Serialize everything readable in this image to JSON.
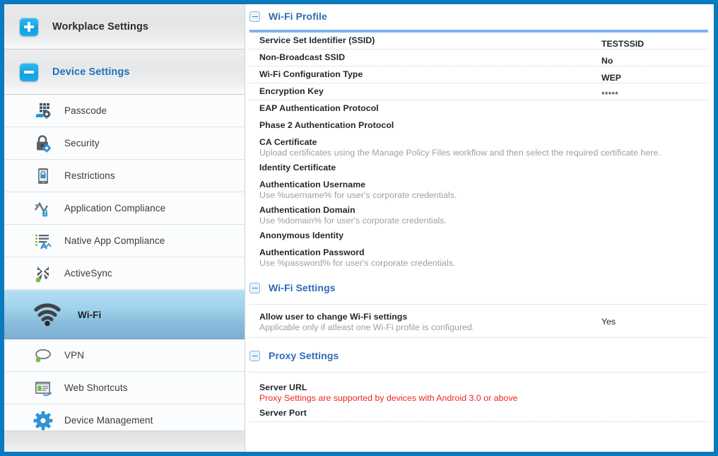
{
  "sidebar": {
    "headers": [
      {
        "label": "Workplace Settings",
        "icon": "plus-toggle-icon",
        "state": "collapsed"
      },
      {
        "label": "Device Settings",
        "icon": "minus-toggle-icon",
        "state": "expanded"
      }
    ],
    "items": [
      {
        "label": "Passcode",
        "icon": "passcode-icon",
        "selected": false
      },
      {
        "label": "Security",
        "icon": "security-lock-icon",
        "selected": false
      },
      {
        "label": "Restrictions",
        "icon": "restrictions-icon",
        "selected": false
      },
      {
        "label": "Application Compliance",
        "icon": "application-compliance-icon",
        "selected": false
      },
      {
        "label": "Native App Compliance",
        "icon": "native-app-compliance-icon",
        "selected": false
      },
      {
        "label": "ActiveSync",
        "icon": "activesync-icon",
        "selected": false
      },
      {
        "label": "Wi-Fi",
        "icon": "wifi-icon",
        "selected": true
      },
      {
        "label": "VPN",
        "icon": "vpn-icon",
        "selected": false
      },
      {
        "label": "Web Shortcuts",
        "icon": "web-shortcuts-icon",
        "selected": false
      },
      {
        "label": "Device Management",
        "icon": "device-management-gear-icon",
        "selected": false
      }
    ]
  },
  "main": {
    "sections": [
      {
        "title": "Wi-Fi Profile",
        "toggle_icon": "collapse-minus-icon",
        "rows": [
          {
            "label": "Service Set Identifier (SSID)",
            "hint": "",
            "value": "TESTSSID"
          },
          {
            "label": "Non-Broadcast SSID",
            "hint": "",
            "value": "No"
          },
          {
            "label": "Wi-Fi Configuration Type",
            "hint": "",
            "value": "WEP"
          },
          {
            "label": "Encryption Key",
            "hint": "",
            "value": "*****"
          },
          {
            "label": "EAP Authentication Protocol",
            "hint": "",
            "value": ""
          },
          {
            "label": "Phase 2 Authentication Protocol",
            "hint": "",
            "value": ""
          },
          {
            "label": "CA Certificate",
            "hint": "Upload certificates using the Manage Policy Files workflow and then select the required certificate here.",
            "value": ""
          },
          {
            "label": "Identity Certificate",
            "hint": "",
            "value": ""
          },
          {
            "label": "Authentication Username",
            "hint": "Use %username% for user's corporate credentials.",
            "value": ""
          },
          {
            "label": "Authentication Domain",
            "hint": "Use %domain% for user's corporate credentials.",
            "value": ""
          },
          {
            "label": "Anonymous Identity",
            "hint": "",
            "value": ""
          },
          {
            "label": "Authentication Password",
            "hint": "Use %password% for user's corporate credentials.",
            "value": ""
          }
        ]
      },
      {
        "title": "Wi-Fi Settings",
        "toggle_icon": "collapse-minus-icon",
        "rows": [
          {
            "label": "Allow user to change Wi-Fi settings",
            "hint": "Applicable only if atleast one Wi-Fi profile is configured.",
            "value": "Yes"
          }
        ]
      },
      {
        "title": "Proxy Settings",
        "toggle_icon": "collapse-minus-icon",
        "rows": [
          {
            "label": "Server URL",
            "hint": "Proxy Settings are supported by devices with Android 3.0 or above",
            "hint_style": "warn",
            "value": ""
          },
          {
            "label": "Server Port",
            "hint": "",
            "value": ""
          }
        ]
      }
    ]
  },
  "colors": {
    "window_border": "#0a79bd",
    "section_title": "#2b6cb8",
    "section_underline": "#7fb3f5",
    "selected_row_top": "#b3dff4",
    "selected_row_bottom": "#7cafd1",
    "warning_text": "#f0231f",
    "toggle_button": "#18a9e8"
  }
}
